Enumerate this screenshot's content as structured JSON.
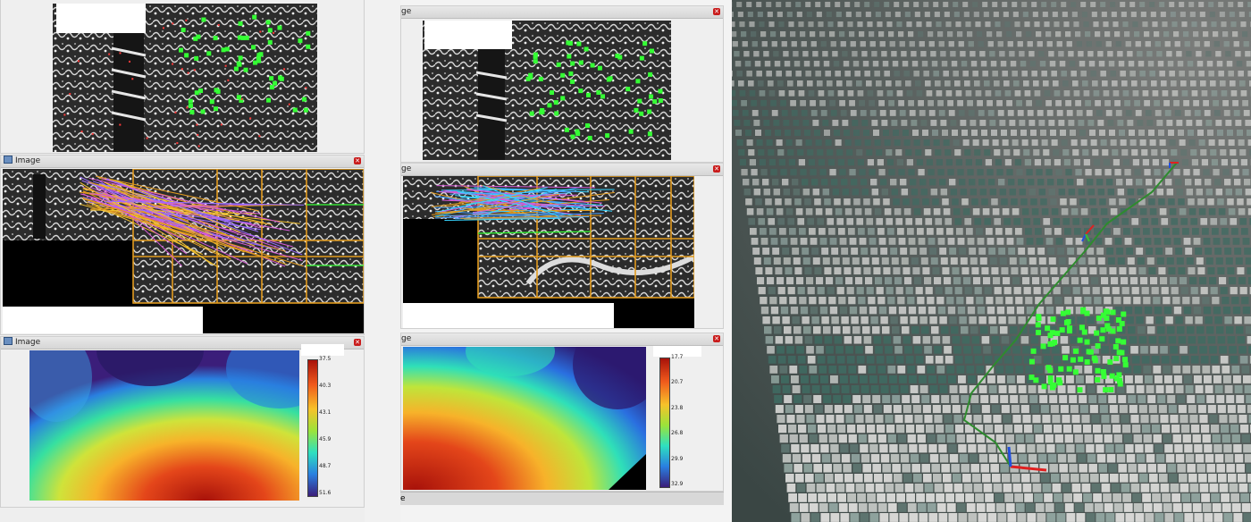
{
  "left_panel": {
    "mid_window": {
      "title": "Image"
    },
    "bottom_window": {
      "title": "Image",
      "colorbar_ticks": [
        "37.5",
        "40.3",
        "43.1",
        "45.9",
        "48.7",
        "51.6"
      ]
    }
  },
  "middle_panel": {
    "top_window": {
      "title": "ge"
    },
    "mid_window": {
      "title": "ge"
    },
    "bottom_window": {
      "title": "ge",
      "colorbar_ticks": [
        "17.7",
        "20.7",
        "23.8",
        "26.8",
        "29.9",
        "32.9"
      ]
    },
    "footer_label": "e"
  },
  "colors": {
    "close_button": "#c91c1c",
    "feature_green": "#35ff35",
    "grid_orange": "#e29b1f",
    "trajectory": "#2e8b2e"
  },
  "icons": [
    "window-icon",
    "close-icon"
  ]
}
